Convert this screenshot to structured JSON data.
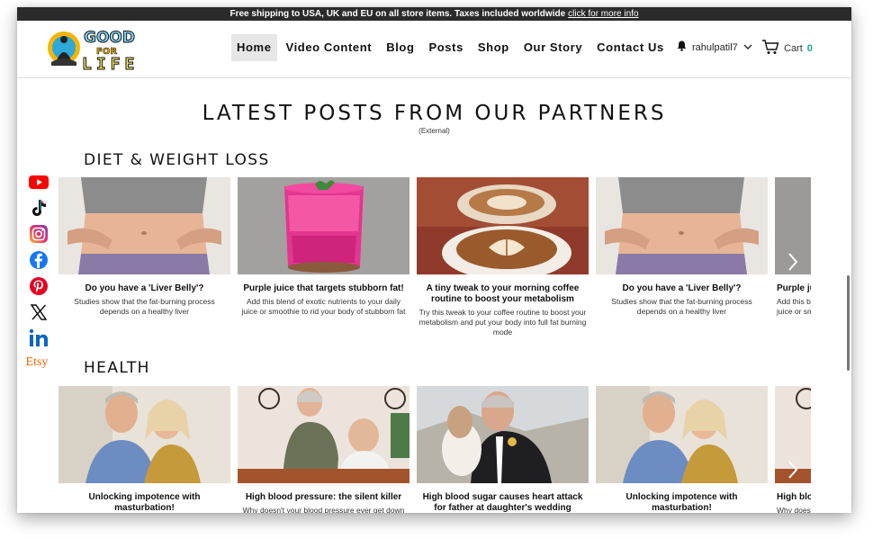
{
  "announcement": {
    "text": "Free shipping to USA, UK and EU on all store items. Taxes included worldwide",
    "link": "click for more info"
  },
  "logo": {
    "line1": "GOOD",
    "line2": "FOR",
    "line3": "LIFE"
  },
  "nav": [
    "Home",
    "Video Content",
    "Blog",
    "Posts",
    "Shop",
    "Our Story",
    "Contact Us"
  ],
  "user": {
    "name": "rahulpatil7"
  },
  "cart": {
    "label": "Cart",
    "count": "0"
  },
  "section": {
    "title": "LATEST POSTS FROM OUR PARTNERS",
    "subtitle": "(External)"
  },
  "social": [
    "youtube-icon",
    "tiktok-icon",
    "instagram-icon",
    "facebook-icon",
    "pinterest-icon",
    "x-icon",
    "linkedin-icon",
    "etsy-icon"
  ],
  "social_etsy_label": "Etsy",
  "diet": {
    "heading": "DIET & WEIGHT LOSS",
    "cards": [
      {
        "title": "Do you have a 'Liver Belly'?",
        "desc": "Studies show that the fat-burning process depends on a healthy liver"
      },
      {
        "title": "Purple juice that targets stubborn fat!",
        "desc": "Add this blend of exotic nutrients to your daily juice or smoothie to rid your body of stubborn fat"
      },
      {
        "title": "A tiny tweak to your morning coffee routine to boost your metabolism",
        "desc": "Try this tweak to your coffee routine to boost your metabolism and put your body into full fat burning mode"
      },
      {
        "title": "Do you have a 'Liver Belly'?",
        "desc": "Studies show that the fat-burning process depends on a healthy liver"
      },
      {
        "title": "Purple juice that targets stubborn fat!",
        "desc": "Add this blend of exotic nutrients to your daily juice or smoothie to rid your body of stubborn fat"
      }
    ]
  },
  "health": {
    "heading": "HEALTH",
    "cards": [
      {
        "title": "Unlocking impotence with masturbation!",
        "desc": ""
      },
      {
        "title": "High blood pressure: the silent killer",
        "desc": "Why doesn't your blood pressure ever get down"
      },
      {
        "title": "High blood sugar causes heart attack for father at daughter's wedding",
        "desc": ""
      },
      {
        "title": "Unlocking impotence with masturbation!",
        "desc": ""
      },
      {
        "title": "High blood pressure: the silent killer",
        "desc": "Why doesn't your blood pressure ever get down"
      }
    ]
  },
  "colors": {
    "topbar": "#2b2b2b",
    "accent": "#19a38a",
    "active_nav": "#e6e6e6"
  }
}
